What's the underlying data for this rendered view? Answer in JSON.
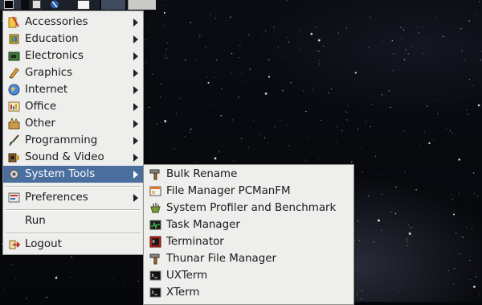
{
  "menu": {
    "items": [
      {
        "label": "Accessories",
        "icon": "accessories-icon",
        "submenu": true
      },
      {
        "label": "Education",
        "icon": "education-icon",
        "submenu": true
      },
      {
        "label": "Electronics",
        "icon": "electronics-icon",
        "submenu": true
      },
      {
        "label": "Graphics",
        "icon": "graphics-icon",
        "submenu": true
      },
      {
        "label": "Internet",
        "icon": "internet-globe-icon",
        "submenu": true
      },
      {
        "label": "Office",
        "icon": "office-icon",
        "submenu": true
      },
      {
        "label": "Other",
        "icon": "other-icon",
        "submenu": true
      },
      {
        "label": "Programming",
        "icon": "programming-brush-icon",
        "submenu": true
      },
      {
        "label": "Sound & Video",
        "icon": "sound-video-icon",
        "submenu": true
      },
      {
        "label": "System Tools",
        "icon": "gear-icon",
        "submenu": true,
        "selected": true
      }
    ],
    "preferences": {
      "label": "Preferences",
      "icon": "preferences-icon"
    },
    "run": {
      "label": "Run"
    },
    "logout": {
      "label": "Logout",
      "icon": "logout-icon"
    }
  },
  "system_tools": {
    "items": [
      {
        "label": "Bulk Rename",
        "icon": "hammer-icon"
      },
      {
        "label": "File Manager PCManFM",
        "icon": "file-manager-icon"
      },
      {
        "label": "System Profiler and Benchmark",
        "icon": "profiler-icon"
      },
      {
        "label": "Task Manager",
        "icon": "task-manager-icon"
      },
      {
        "label": "Terminator",
        "icon": "terminator-icon"
      },
      {
        "label": "Thunar File Manager",
        "icon": "hammer-icon"
      },
      {
        "label": "UXTerm",
        "icon": "terminal-icon"
      },
      {
        "label": "XTerm",
        "icon": "terminal-icon"
      }
    ]
  },
  "colors": {
    "menu_bg": "#eeeeec",
    "selection": "#4a6f9f",
    "desktop": "#05070b"
  }
}
